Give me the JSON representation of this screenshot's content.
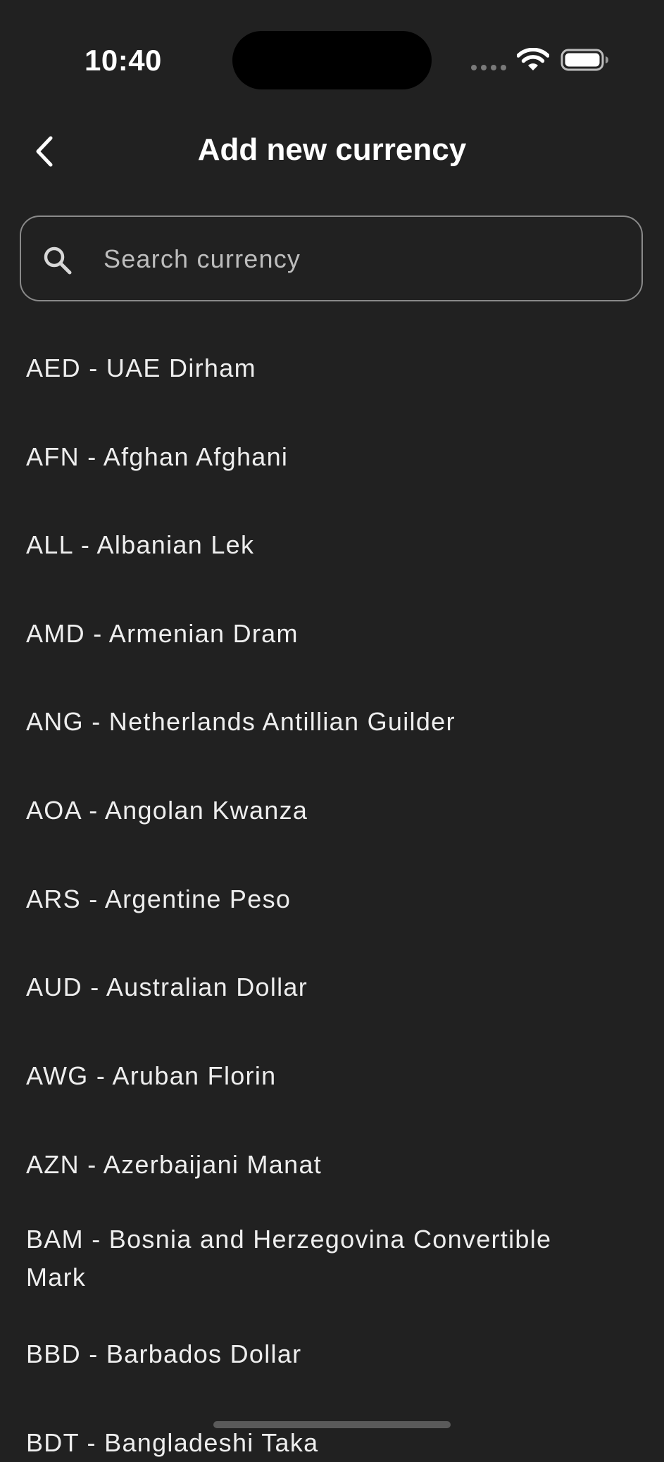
{
  "status_bar": {
    "time": "10:40"
  },
  "header": {
    "title": "Add new currency"
  },
  "search": {
    "placeholder": "Search currency",
    "value": ""
  },
  "currencies": [
    "AED - UAE Dirham",
    "AFN - Afghan Afghani",
    "ALL - Albanian Lek",
    "AMD - Armenian Dram",
    "ANG - Netherlands Antillian Guilder",
    "AOA - Angolan Kwanza",
    "ARS - Argentine Peso",
    "AUD - Australian Dollar",
    "AWG - Aruban Florin",
    "AZN - Azerbaijani Manat",
    "BAM - Bosnia and Herzegovina Convertible Mark",
    "BBD - Barbados Dollar",
    "BDT - Bangladeshi Taka"
  ],
  "icons": {
    "back": "chevron-left-icon",
    "search": "search-icon",
    "wifi": "wifi-icon",
    "battery": "battery-icon",
    "signal": "cellular-signal-icon"
  },
  "colors": {
    "background": "#212121",
    "text": "#eeeeee",
    "border": "#8a8a8a"
  }
}
